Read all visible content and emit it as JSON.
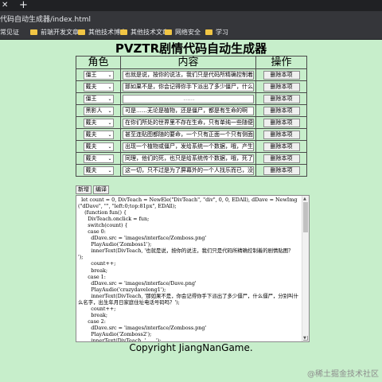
{
  "browser": {
    "address": "代码自动生成器/index.html",
    "bookmarks": [
      "常见证",
      "前端开发文章",
      "其他技术博客",
      "其他技术文章",
      "网络安全",
      "学习"
    ]
  },
  "page": {
    "title": "PVZTR剧情代码自动生成器",
    "headers": [
      "角色",
      "内容",
      "操作"
    ],
    "rows": [
      {
        "role": "僵王",
        "text": "也就是说，按你的说法，我们只是代码所精确控制着的剧",
        "placeholder": false
      },
      {
        "role": "戴夫",
        "text": "那如果不是，你会记得你手下派出了多少僵尸，什么僵尸，",
        "placeholder": false
      },
      {
        "role": "僵王",
        "text": "……",
        "placeholder": true
      },
      {
        "role": "黑影人",
        "text": "可是……无论是植物，还是僵尸，都是有生命的啊",
        "placeholder": false
      },
      {
        "role": "戴夫",
        "text": "在你们所处的世界里不存在生命，只有单纯一些随便找人填",
        "placeholder": false
      },
      {
        "role": "戴夫",
        "text": "甚至连贴图都随的要命，一个只有正面一个只有侧面，还有一",
        "placeholder": false
      },
      {
        "role": "戴夫",
        "text": "出现一个植物或僵尸，发给系统一个数据，哦，产生了",
        "placeholder": false
      },
      {
        "role": "戴夫",
        "text": "同理，他们的死，也只是给系统传个数据，哦，死了，数据",
        "placeholder": false
      },
      {
        "role": "戴夫",
        "text": "这一切，只不过是为了屏幕外的一个人找乐而已，没有任何",
        "placeholder": false
      }
    ],
    "delete_label": "删除本项",
    "add_label": "新增",
    "generate_label": "编译",
    "code": "  let count = 0, DivTeach = NewEle(\"DivTeach\", \"div\", 0, 0, EDAll), dDave = NewImg(\"dDave\", \"\", \"left:0;top:81px\", EDAll);\n    (function fun() {\n      DivTeach.onclick = fun;\n      switch(count) {\n      case 0:\n        dDave.src = 'images/interface/Zomboss.png'\n        PlayAudio('Zomboss1');\n        innerText(DivTeach, '也就是说，按你的说法，我们只是代码所精确控制着的剧情贴图？ ');\n        count++;\n        break;\n      case 1:\n        dDave.src = 'images/interface/Dave.png'\n        PlayAudio('crazydavelong1');\n        innerText(DivTeach, '那如果不是，你会记得你手下派出了多少僵尸，什么僵尸，分别叫什么名字，出生年月日家庭住址电话号码吗？');\n        count++;\n        break;\n      case 2:\n        dDave.src = 'images/interface/Zomboss.png'\n        PlayAudio('Zomboss2');\n        innerText(DivTeach, '……');\n        count++;\n        break;\n      case 3:\n        dDave.src = 'images/interface/Black_Dave.png'",
    "copyright": "Copyright JiangNanGame.",
    "watermark": "@稀土掘金技术社区"
  }
}
